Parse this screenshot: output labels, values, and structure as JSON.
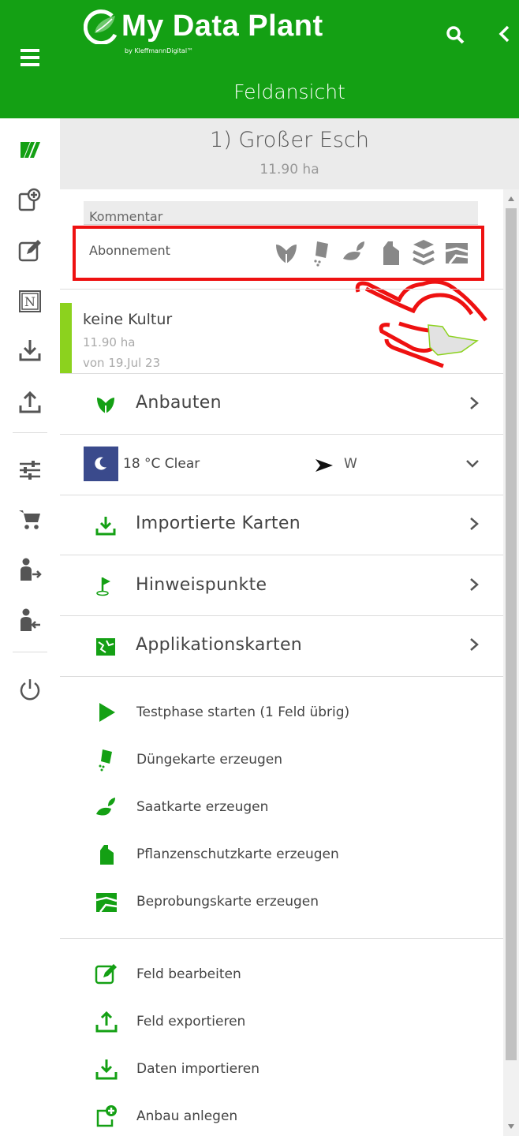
{
  "app": {
    "logo_title": "My Data Plant",
    "logo_subtitle": "by KleffmannDigital™",
    "page_title": "Feldansicht"
  },
  "header": {
    "search_icon": "search-icon",
    "back_icon": "chevron-left-icon"
  },
  "sidebar": {
    "items": [
      {
        "icon": "fields-icon",
        "active": true
      },
      {
        "icon": "add-crop-icon"
      },
      {
        "icon": "edit-icon"
      },
      {
        "icon": "notes-n-icon"
      },
      {
        "icon": "download-icon"
      },
      {
        "icon": "upload-icon"
      },
      {
        "icon": "settings-sliders-icon"
      },
      {
        "icon": "cart-icon"
      },
      {
        "icon": "user-logout-icon"
      },
      {
        "icon": "user-login-icon"
      },
      {
        "icon": "power-icon"
      }
    ]
  },
  "field": {
    "name": "1) Großer Esch",
    "area": "11.90 ha"
  },
  "comment": {
    "placeholder": "Kommentar"
  },
  "subscription": {
    "label": "Abonnement",
    "icons": [
      "leaf-icon",
      "fertilizer-bag-icon",
      "seed-sprout-icon",
      "spray-canister-icon",
      "layers-icon",
      "sampling-map-icon"
    ]
  },
  "culture": {
    "name": "keine Kultur",
    "area": "11.90 ha",
    "date": "von 19.Jul 23"
  },
  "sections": {
    "anbauten": "Anbauten",
    "importierte_karten": "Importierte Karten",
    "hinweispunkte": "Hinweispunkte",
    "applikationskarten": "Applikationskarten"
  },
  "weather": {
    "text": "18 °C Clear",
    "wind_direction": "W"
  },
  "actions": {
    "testphase": "Testphase starten (1 Feld übrig)",
    "duengekarte": "Düngekarte erzeugen",
    "saatkarte": "Saatkarte erzeugen",
    "pflanzenschutzkarte": "Pflanzenschutzkarte erzeugen",
    "beprobungskarte": "Beprobungskarte erzeugen",
    "feld_bearbeiten": "Feld bearbeiten",
    "feld_exportieren": "Feld exportieren",
    "daten_importieren": "Daten importieren",
    "anbau_anlegen": "Anbau anlegen"
  },
  "colors": {
    "brand_green": "#14a014",
    "accent_green": "#8cd21e",
    "highlight_red": "#ee1111",
    "weather_night": "#3a4a8c"
  }
}
